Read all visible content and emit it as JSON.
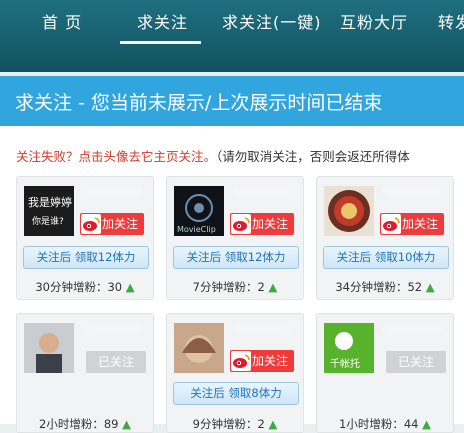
{
  "nav": {
    "items": [
      "首 页",
      "求关注",
      "求关注(一键)",
      "互粉大厅",
      "转发"
    ],
    "active_index": 1
  },
  "banner": {
    "title": "求关注 - 您当前未展示/上次展示时间已结束"
  },
  "notice": {
    "failed": "关注失败？点击头像去它主页关注。",
    "warning": "（请勿取消关注，否则会返还所得体"
  },
  "cards": [
    {
      "status_label": "加关注",
      "reward": "关注后 领取12体力",
      "growth": "30分钟增粉：30",
      "avatar_text": [
        "我是婷婷",
        "你是谁?"
      ]
    },
    {
      "status_label": "加关注",
      "reward": "关注后 领取12体力",
      "growth": "7分钟增粉：2",
      "avatar_text": [
        "MovieClip"
      ]
    },
    {
      "status_label": "加关注",
      "reward": "关注后 领取10体力",
      "growth": "34分钟增粉：52"
    },
    {
      "status_label": "已关注",
      "growth": "2小时增粉：89"
    },
    {
      "status_label": "加关注",
      "reward": "关注后 领取8体力",
      "growth": "9分钟增粉：2"
    },
    {
      "status_label": "已关注",
      "growth": "1小时增粉：44",
      "avatar_text": [
        "千帐托"
      ]
    }
  ],
  "arrow_icon": "▲",
  "colors": {
    "nav_bg": "#1a6676",
    "banner_bg": "#31a6de",
    "follow_red": "#ef3b3b",
    "link_blue": "#1d74b8",
    "arrow_green": "#3caa3c"
  }
}
